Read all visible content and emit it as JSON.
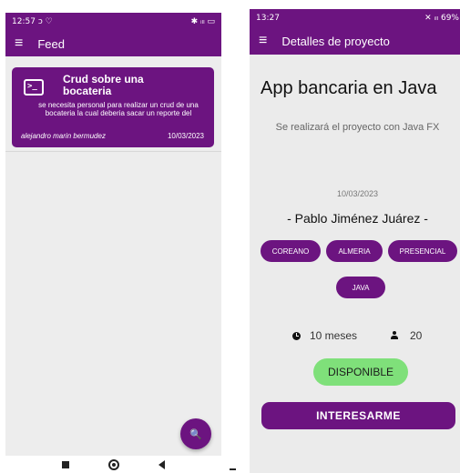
{
  "left": {
    "status": {
      "time": "12:57",
      "icons_left": "ↄ ♡",
      "icons_right": "✱ ᵢₗₗ ▭"
    },
    "appbar": {
      "menu_icon": "≡",
      "title": "Feed"
    },
    "card": {
      "icon_glyph": ">_",
      "title": "Crud sobre una bocateria",
      "description": "se necesita personal para realizar un crud de una bocateria la cual deberia sacar un reporte del",
      "author": "alejandro marin bermudez",
      "date": "10/03/2023"
    },
    "fab": {
      "icon_glyph": "🔍"
    }
  },
  "right": {
    "status": {
      "time": "13:27",
      "icons_right": "✕ ᵢₗₗ 69%"
    },
    "appbar": {
      "menu_icon": "≡",
      "title": "Detalles de proyecto"
    },
    "project": {
      "title": "App bancaria en Java",
      "description": "Se realizará el proyecto con Java FX",
      "date": "10/03/2023",
      "author": "- Pablo Jiménez Juárez  -",
      "chips": [
        "COREANO",
        "ALMERIA",
        "PRESENCIAL",
        "JAVA"
      ],
      "duration": "10 meses",
      "people": "20",
      "status": "DISPONIBLE",
      "action": "INTERESARME"
    }
  },
  "colors": {
    "primary": "#6c1480",
    "available": "#7fe07a",
    "background": "#ebebeb"
  }
}
